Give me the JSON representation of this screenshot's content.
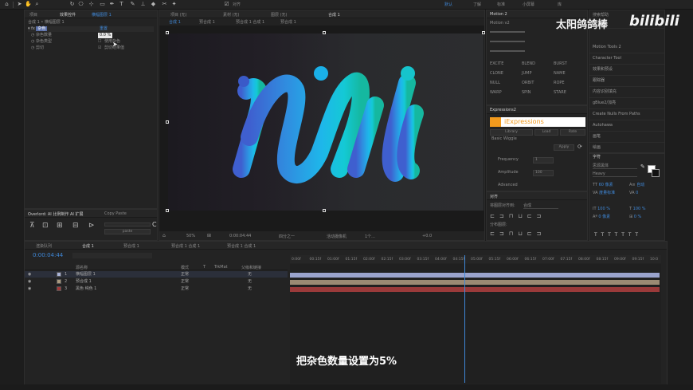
{
  "toolbar": {
    "snap_label": "对齐",
    "workspaces": [
      "默认",
      "了解",
      "标准",
      "小屏幕",
      "库"
    ]
  },
  "project_panel": {
    "tabs": [
      "项目",
      "效果控件",
      "横幅图层 1"
    ],
    "breadcrumb": "合成 1 • 横幅图层 1",
    "fx_name": "杂色",
    "reset": "重置",
    "params": [
      {
        "label": "杂色数量",
        "value": "0.0 %"
      },
      {
        "label": "杂色类型",
        "value": "使用杂色"
      },
      {
        "label": "剪切",
        "value": "剪切结果值"
      }
    ]
  },
  "overlord": {
    "title": "Overlord: AI 比例制作 AI 扩展",
    "copy_paste": "Copy Paste",
    "paste": "paste"
  },
  "viewer": {
    "tabs": [
      "合成 1",
      "项目 (无)",
      "素材 (无)",
      "图层 (无)"
    ],
    "comp_tabs": [
      "合成 1",
      "预合成 1",
      "预合成 1 合成 1",
      "预合成 1"
    ],
    "zoom": "50%",
    "timecode": "0:00:04:44",
    "quality": "四分之一",
    "camera": "活动摄像机",
    "views": "1个...",
    "offset": "+0.0"
  },
  "artwork": {
    "title": "Nili",
    "colors": [
      "#3f5fcf",
      "#2f8fe0",
      "#1eb7ea",
      "#14c9d5",
      "#15b8a0"
    ]
  },
  "motion": {
    "title": "Motion 2",
    "version": "Motion v2",
    "buttons": [
      "EXCITE",
      "BLEND",
      "BURST",
      "CLONE",
      "JUMP",
      "NAME",
      "NULL",
      "ORBIT",
      "ROPE",
      "WARP",
      "SPIN",
      "STARE"
    ]
  },
  "expressions": {
    "title": "Expressions2",
    "brand": "iExpressions",
    "tabs": [
      "Library",
      "Load",
      "Rate"
    ],
    "section": "Basic Wiggle",
    "apply": "Apply",
    "fields": [
      {
        "label": "Frequency",
        "value": "1"
      },
      {
        "label": "Amplitude",
        "value": "100"
      }
    ],
    "advanced": "Advanced"
  },
  "align": {
    "title": "对齐",
    "align_to_label": "将图层对齐到:",
    "align_to_value": "合成",
    "distribute": "分布图层:"
  },
  "right_menu": {
    "search": "搜索帮助",
    "items": [
      "信息",
      "Motion Tools 2",
      "Character Tool",
      "效果和预设",
      "跟踪器",
      "内容识别填充",
      "gBlue2/加亮",
      "Create Nulls From Paths",
      "Autohawa",
      "画笔",
      "绘画"
    ]
  },
  "character": {
    "title": "字符",
    "font": "思源黑体",
    "style": "Heavy",
    "size": "60 像素",
    "leading": "自动",
    "kerning": "度量标准",
    "tracking": "0",
    "scale_v": "100 %",
    "scale_h": "100 %",
    "baseline": "0 像素",
    "tsume": "0 %",
    "unit": "像素"
  },
  "watermark": {
    "author": "太阳鸽鸽棒",
    "site": "bilibili"
  },
  "timeline": {
    "tabs": [
      "渲染队列",
      "合成 1",
      "预合成 1",
      "预合成 1 合成 1",
      "预合成 1 合成 1"
    ],
    "timecode": "0:00:04:44",
    "columns": [
      "源名称",
      "模式",
      "T",
      "TrkMat",
      "父级和链接"
    ],
    "layers": [
      {
        "num": "1",
        "name": "横幅图层 1",
        "color": "#a9b3d8",
        "mode": "正常",
        "parent": "无"
      },
      {
        "num": "2",
        "name": "预合成 1",
        "color": "#a99a7e",
        "mode": "正常",
        "parent": "无"
      },
      {
        "num": "3",
        "name": "黑色 纯色 1",
        "color": "#a33a3a",
        "mode": "正常",
        "parent": "无"
      }
    ],
    "ruler": [
      "0:00f",
      "00:15f",
      "01:00f",
      "01:15f",
      "02:00f",
      "02:15f",
      "03:00f",
      "03:15f",
      "04:00f",
      "04:15f",
      "05:00f",
      "05:15f",
      "06:00f",
      "06:15f",
      "07:00f",
      "07:15f",
      "08:00f",
      "08:15f",
      "09:00f",
      "09:15f",
      "10:0"
    ],
    "playhead_fraction": 0.47,
    "bar_colors": [
      "#9aa3cc",
      "#9a8a73",
      "#9a3a3a"
    ]
  },
  "subtitle": "把杂色数量设置为5%"
}
